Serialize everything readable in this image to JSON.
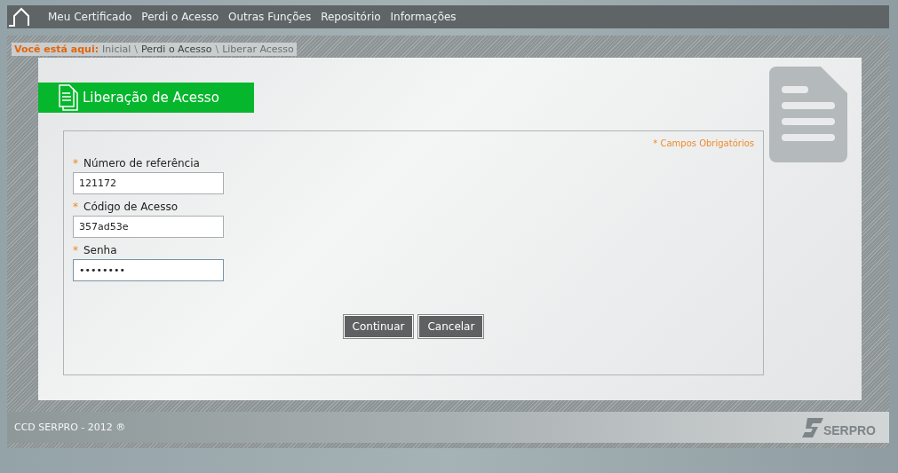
{
  "nav": {
    "items": [
      "Meu Certificado",
      "Perdi o Acesso",
      "Outras Funções",
      "Repositório",
      "Informações"
    ]
  },
  "breadcrumb": {
    "label": "Você está aqui:",
    "items": [
      "Inicial",
      "Perdi o Acesso",
      "Liberar Acesso"
    ],
    "separator": "\\"
  },
  "page_title": "Liberação de Acesso",
  "required_note": "* Campos Obrigatórios",
  "fields": [
    {
      "label": "Número de referência",
      "value": "121172",
      "required": true,
      "focused": false
    },
    {
      "label": "Código de Acesso",
      "value": "357ad53e",
      "required": true,
      "focused": false
    },
    {
      "label": "Senha",
      "value": "••••••••",
      "required": true,
      "focused": true
    }
  ],
  "required_mark": "*",
  "buttons": [
    "Continuar",
    "Cancelar"
  ],
  "footer": {
    "text": "CCD SERPRO - 2012 ®",
    "logo_text": "SERPRO"
  }
}
